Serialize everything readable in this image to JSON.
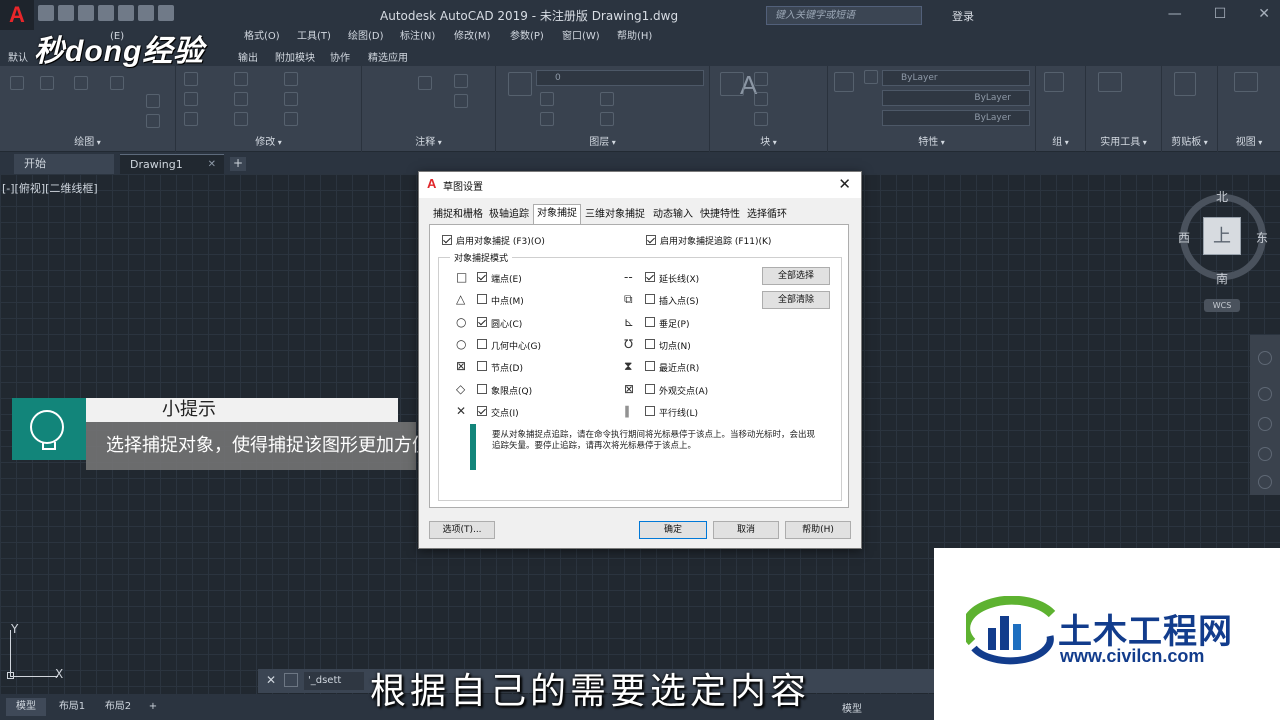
{
  "titlebar": {
    "app_logo": "A",
    "title": "Autodesk AutoCAD 2019 - 未注册版      Drawing1.dwg",
    "search_placeholder": "键入关键字或短语",
    "login": "登录"
  },
  "menu": {
    "items": [
      "(E)",
      "格式(O)",
      "工具(T)",
      "绘图(D)",
      "标注(N)",
      "修改(M)",
      "参数(P)",
      "窗口(W)",
      "帮助(H)"
    ]
  },
  "ribbon_tabs": [
    "默认",
    "输出",
    "附加模块",
    "协作",
    "精选应用"
  ],
  "ribbon_groups": {
    "draw": "绘图",
    "modify": "修改",
    "annotate": "注释",
    "layers": "图层",
    "block": "块",
    "properties": "特性",
    "groups": "组",
    "utilities": "实用工具",
    "clipboard": "剪贴板",
    "view": "视图",
    "bylayer": "ByLayer",
    "layer_value": "0"
  },
  "watermark": "秒dong经验",
  "doc_tabs": {
    "start": "开始",
    "drawing": "Drawing1"
  },
  "viewport_label": "[-][俯视][二维线框]",
  "viewcube": {
    "north": "北",
    "south": "南",
    "west": "西",
    "east": "东",
    "face": "上",
    "wcs": "WCS"
  },
  "ucs": {
    "x": "X",
    "y": "Y"
  },
  "cmdline": {
    "input": "'_dsett"
  },
  "bottom_tabs": [
    "模型",
    "布局1",
    "布局2"
  ],
  "status": {
    "model": "模型"
  },
  "tip": {
    "title": "小提示",
    "body": "选择捕捉对象，使得捕捉该图形更加方便"
  },
  "dialog": {
    "title": "草图设置",
    "tabs": [
      "捕捉和栅格",
      "极轴追踪",
      "对象捕捉",
      "三维对象捕捉",
      "动态输入",
      "快捷特性",
      "选择循环"
    ],
    "active_tab": "对象捕捉",
    "enable_osnap": "启用对象捕捉 (F3)(O)",
    "enable_tracking": "启用对象捕捉追踪 (F11)(K)",
    "modes_legend": "对象捕捉模式",
    "left_modes": [
      {
        "symbol": "□",
        "label": "端点(E)",
        "checked": true
      },
      {
        "symbol": "△",
        "label": "中点(M)",
        "checked": false
      },
      {
        "symbol": "○",
        "label": "圆心(C)",
        "checked": true
      },
      {
        "symbol": "○",
        "label": "几何中心(G)",
        "checked": false
      },
      {
        "symbol": "⊠",
        "label": "节点(D)",
        "checked": false
      },
      {
        "symbol": "◇",
        "label": "象限点(Q)",
        "checked": false
      },
      {
        "symbol": "✕",
        "label": "交点(I)",
        "checked": true
      }
    ],
    "right_modes": [
      {
        "symbol": "--",
        "label": "延长线(X)",
        "checked": true
      },
      {
        "symbol": "⧉",
        "label": "插入点(S)",
        "checked": false
      },
      {
        "symbol": "⊾",
        "label": "垂足(P)",
        "checked": false
      },
      {
        "symbol": "℧",
        "label": "切点(N)",
        "checked": false
      },
      {
        "symbol": "⧗",
        "label": "最近点(R)",
        "checked": false
      },
      {
        "symbol": "⊠",
        "label": "外观交点(A)",
        "checked": false
      },
      {
        "symbol": "∥",
        "label": "平行线(L)",
        "checked": false
      }
    ],
    "select_all": "全部选择",
    "clear_all": "全部清除",
    "info": "要从对象捕捉点追踪，请在命令执行期间将光标悬停于该点上。当移动光标时，会出现追踪矢量。要停止追踪，请再次将光标悬停于该点上。",
    "options_btn": "选项(T)...",
    "ok_btn": "确定",
    "cancel_btn": "取消",
    "help_btn": "帮助(H)"
  },
  "logo": {
    "cn": "土木工程网",
    "url": "www.civilcn.com"
  },
  "subtitle": "根据自己的需要选定内容",
  "colors": {
    "accent_teal": "#12857a",
    "logo_blue": "#123c8c",
    "logo_green": "#5db230",
    "autocad_red": "#e0262a"
  }
}
